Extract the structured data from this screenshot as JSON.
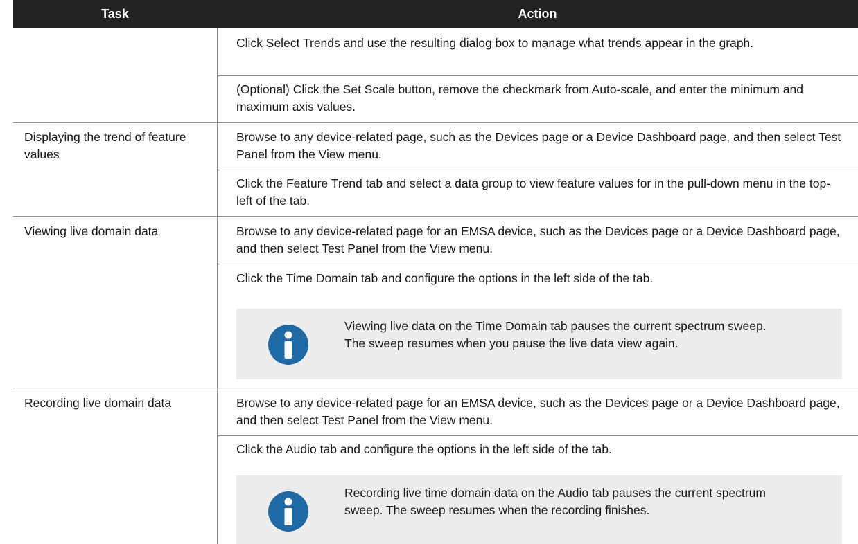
{
  "table": {
    "headers": {
      "task": "Task",
      "action": "Action"
    },
    "rows": [
      {
        "task": "",
        "actions": [
          "Click Select Trends and use the resulting dialog box to manage what trends appear in the graph.",
          "(Optional) Click the Set Scale button, remove the checkmark from Auto-scale, and enter the minimum and maximum axis values."
        ]
      },
      {
        "task": "Displaying the trend of feature values",
        "actions": [
          "Browse to any device-related page, such as the Devices page or a Device Dashboard page, and then select Test Panel from the View menu.",
          "Click the Feature Trend tab and select a data group to view feature values for in the pull-down menu in the top-left of the tab."
        ]
      },
      {
        "task": "Viewing live domain data",
        "actions": [
          "Browse to any device-related page for an EMSA device, such as the Devices page or a Device Dashboard page, and then select Test Panel from the View menu.",
          "Click the Time Domain tab and configure the options in the left side of the tab."
        ],
        "note": "Viewing live data on the Time Domain tab pauses the current spectrum sweep. The sweep resumes when you pause the live data view again."
      },
      {
        "task": "Recording live domain data",
        "actions": [
          "Browse to any device-related page for an EMSA device, such as the Devices page or a Device Dashboard page, and then select Test Panel from the View menu.",
          "Click the Audio tab and configure the options in the left side of the tab."
        ],
        "note": "Recording live time domain data on the Audio tab pauses the current spectrum sweep. The sweep resumes when the recording finishes."
      }
    ]
  },
  "colors": {
    "header_bg": "#222222",
    "header_text": "#ffffff",
    "rule": "#8c8c8c",
    "note_bg": "#ededed",
    "info_icon": "#1f6aa5"
  },
  "icons": {
    "note_icon": "info-icon"
  }
}
